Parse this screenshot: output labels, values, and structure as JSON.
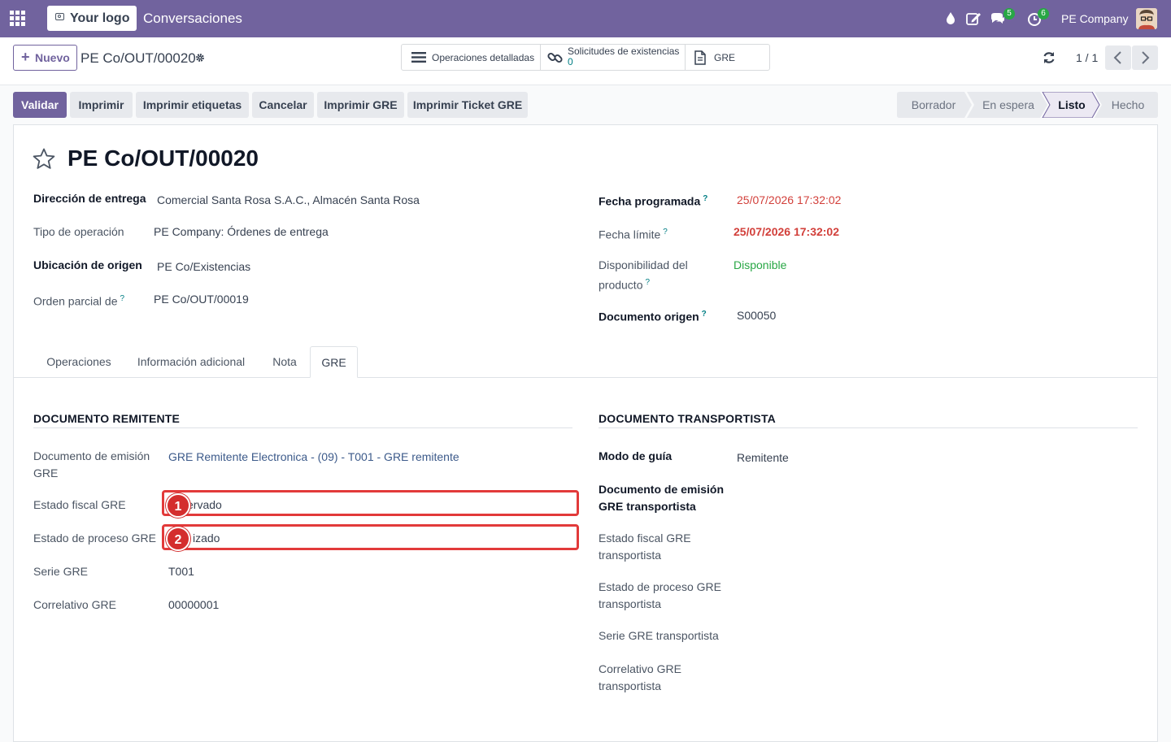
{
  "navbar": {
    "logo_text": "Your logo",
    "app_name": "Conversaciones",
    "messages_badge": "5",
    "activities_badge": "6",
    "company": "PE Company"
  },
  "control_panel": {
    "new_button": "Nuevo",
    "breadcrumb": "PE Co/OUT/00020",
    "smart_buttons": [
      {
        "label": "Operaciones detalladas",
        "icon": "list-icon"
      },
      {
        "label": "Solicitudes de existencias",
        "value": "0",
        "icon": "link-icon"
      },
      {
        "label": "GRE",
        "icon": "document-icon"
      }
    ],
    "pager": "1 / 1"
  },
  "actions": [
    "Validar",
    "Imprimir",
    "Imprimir etiquetas",
    "Cancelar",
    "Imprimir GRE",
    "Imprimir Ticket GRE"
  ],
  "status_stages": [
    "Borrador",
    "En espera",
    "Listo",
    "Hecho"
  ],
  "active_stage": "Listo",
  "record": {
    "title": "PE Co/OUT/00020",
    "left_fields": [
      {
        "label": "Dirección de entrega",
        "value": "Comercial Santa Rosa S.A.C., Almacén Santa Rosa"
      },
      {
        "label": "Tipo de operación",
        "value": "PE Company: Órdenes de entrega"
      },
      {
        "label": "Ubicación de origen",
        "value": "PE Co/Existencias"
      },
      {
        "label": "Orden parcial de",
        "value": "PE Co/OUT/00019"
      }
    ],
    "right_fields": [
      {
        "label": "Fecha programada",
        "value": "25/07/2026 17:32:02"
      },
      {
        "label": "Fecha límite",
        "value": "25/07/2026 17:32:02"
      },
      {
        "label": "Disponibilidad del producto",
        "value": "Disponible"
      },
      {
        "label": "Documento origen",
        "value": "S00050"
      }
    ]
  },
  "tabs": [
    "Operaciones",
    "Información adicional",
    "Nota",
    "GRE"
  ],
  "active_tab": "GRE",
  "gre": {
    "remitente_title": "DOCUMENTO REMITENTE",
    "remitente_fields": [
      {
        "label": "Documento de emisión GRE",
        "value": "GRE Remitente Electronica - (09) - T001 - GRE remitente"
      },
      {
        "label": "Estado fiscal GRE",
        "value": "ervado"
      },
      {
        "label": "Estado de proceso GRE",
        "value": "izado"
      },
      {
        "label": "Serie GRE",
        "value": "T001"
      },
      {
        "label": "Correlativo GRE",
        "value": "00000001"
      }
    ],
    "transportista_title": "DOCUMENTO TRANSPORTISTA",
    "transportista_fields": [
      {
        "label": "Modo de guía",
        "value": "Remitente"
      },
      {
        "label": "Documento de emisión GRE transportista",
        "value": ""
      },
      {
        "label": "Estado fiscal GRE transportista",
        "value": ""
      },
      {
        "label": "Estado de proceso GRE transportista",
        "value": ""
      },
      {
        "label": "Serie GRE transportista",
        "value": ""
      },
      {
        "label": "Correlativo GRE transportista",
        "value": ""
      }
    ]
  },
  "annotations": [
    "1",
    "2"
  ],
  "colors": {
    "brand": "#71639e",
    "danger": "#d23f3a",
    "success": "#28a745",
    "highlight": "#e23a3a"
  }
}
